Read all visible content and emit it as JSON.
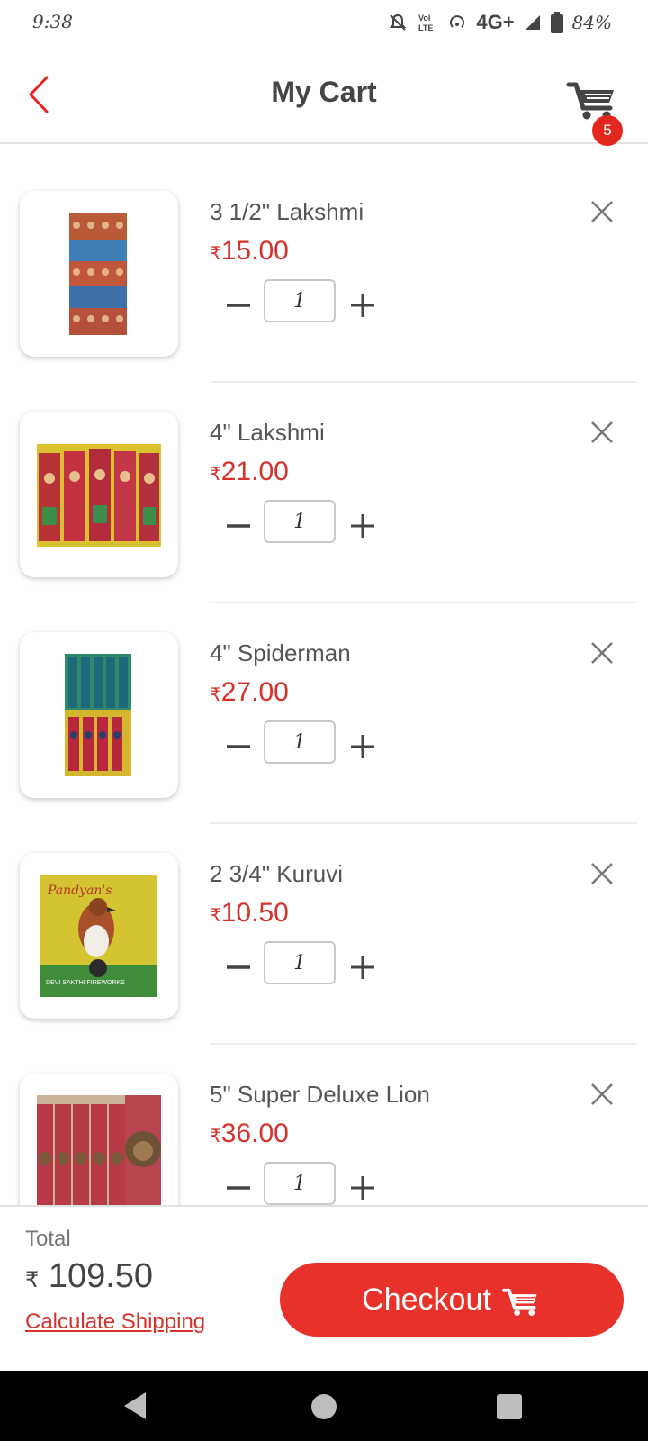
{
  "status_bar": {
    "time": "9:38",
    "network": "4G+",
    "battery": "84%",
    "icons": [
      "mute-icon",
      "volte-icon",
      "hotspot-icon",
      "signal-icon",
      "battery-icon"
    ]
  },
  "header": {
    "title": "My Cart",
    "cart_count": "5",
    "accent_color": "#e3261e"
  },
  "cart": {
    "currency_symbol": "₹",
    "items": [
      {
        "name": "3 1/2\" Lakshmi",
        "price": "15.00",
        "quantity": "1"
      },
      {
        "name": "4\" Lakshmi",
        "price": "21.00",
        "quantity": "1"
      },
      {
        "name": "4\" Spiderman",
        "price": "27.00",
        "quantity": "1"
      },
      {
        "name": "2 3/4\" Kuruvi",
        "price": "10.50",
        "quantity": "1"
      },
      {
        "name": "5\" Super Deluxe Lion",
        "price": "36.00",
        "quantity": "1"
      }
    ]
  },
  "footer": {
    "total_label": "Total",
    "currency_symbol": "₹",
    "total_value": "109.50",
    "shipping_link": "Calculate Shipping",
    "checkout_label": "Checkout"
  }
}
